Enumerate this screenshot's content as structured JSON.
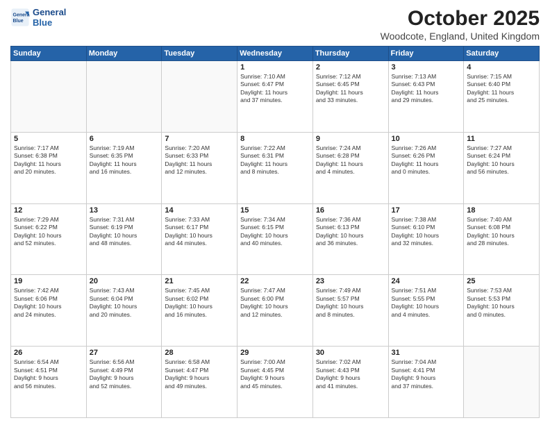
{
  "header": {
    "logo_line1": "General",
    "logo_line2": "Blue",
    "month": "October 2025",
    "location": "Woodcote, England, United Kingdom"
  },
  "weekdays": [
    "Sunday",
    "Monday",
    "Tuesday",
    "Wednesday",
    "Thursday",
    "Friday",
    "Saturday"
  ],
  "weeks": [
    [
      {
        "day": "",
        "info": ""
      },
      {
        "day": "",
        "info": ""
      },
      {
        "day": "",
        "info": ""
      },
      {
        "day": "1",
        "info": "Sunrise: 7:10 AM\nSunset: 6:47 PM\nDaylight: 11 hours\nand 37 minutes."
      },
      {
        "day": "2",
        "info": "Sunrise: 7:12 AM\nSunset: 6:45 PM\nDaylight: 11 hours\nand 33 minutes."
      },
      {
        "day": "3",
        "info": "Sunrise: 7:13 AM\nSunset: 6:43 PM\nDaylight: 11 hours\nand 29 minutes."
      },
      {
        "day": "4",
        "info": "Sunrise: 7:15 AM\nSunset: 6:40 PM\nDaylight: 11 hours\nand 25 minutes."
      }
    ],
    [
      {
        "day": "5",
        "info": "Sunrise: 7:17 AM\nSunset: 6:38 PM\nDaylight: 11 hours\nand 20 minutes."
      },
      {
        "day": "6",
        "info": "Sunrise: 7:19 AM\nSunset: 6:35 PM\nDaylight: 11 hours\nand 16 minutes."
      },
      {
        "day": "7",
        "info": "Sunrise: 7:20 AM\nSunset: 6:33 PM\nDaylight: 11 hours\nand 12 minutes."
      },
      {
        "day": "8",
        "info": "Sunrise: 7:22 AM\nSunset: 6:31 PM\nDaylight: 11 hours\nand 8 minutes."
      },
      {
        "day": "9",
        "info": "Sunrise: 7:24 AM\nSunset: 6:28 PM\nDaylight: 11 hours\nand 4 minutes."
      },
      {
        "day": "10",
        "info": "Sunrise: 7:26 AM\nSunset: 6:26 PM\nDaylight: 11 hours\nand 0 minutes."
      },
      {
        "day": "11",
        "info": "Sunrise: 7:27 AM\nSunset: 6:24 PM\nDaylight: 10 hours\nand 56 minutes."
      }
    ],
    [
      {
        "day": "12",
        "info": "Sunrise: 7:29 AM\nSunset: 6:22 PM\nDaylight: 10 hours\nand 52 minutes."
      },
      {
        "day": "13",
        "info": "Sunrise: 7:31 AM\nSunset: 6:19 PM\nDaylight: 10 hours\nand 48 minutes."
      },
      {
        "day": "14",
        "info": "Sunrise: 7:33 AM\nSunset: 6:17 PM\nDaylight: 10 hours\nand 44 minutes."
      },
      {
        "day": "15",
        "info": "Sunrise: 7:34 AM\nSunset: 6:15 PM\nDaylight: 10 hours\nand 40 minutes."
      },
      {
        "day": "16",
        "info": "Sunrise: 7:36 AM\nSunset: 6:13 PM\nDaylight: 10 hours\nand 36 minutes."
      },
      {
        "day": "17",
        "info": "Sunrise: 7:38 AM\nSunset: 6:10 PM\nDaylight: 10 hours\nand 32 minutes."
      },
      {
        "day": "18",
        "info": "Sunrise: 7:40 AM\nSunset: 6:08 PM\nDaylight: 10 hours\nand 28 minutes."
      }
    ],
    [
      {
        "day": "19",
        "info": "Sunrise: 7:42 AM\nSunset: 6:06 PM\nDaylight: 10 hours\nand 24 minutes."
      },
      {
        "day": "20",
        "info": "Sunrise: 7:43 AM\nSunset: 6:04 PM\nDaylight: 10 hours\nand 20 minutes."
      },
      {
        "day": "21",
        "info": "Sunrise: 7:45 AM\nSunset: 6:02 PM\nDaylight: 10 hours\nand 16 minutes."
      },
      {
        "day": "22",
        "info": "Sunrise: 7:47 AM\nSunset: 6:00 PM\nDaylight: 10 hours\nand 12 minutes."
      },
      {
        "day": "23",
        "info": "Sunrise: 7:49 AM\nSunset: 5:57 PM\nDaylight: 10 hours\nand 8 minutes."
      },
      {
        "day": "24",
        "info": "Sunrise: 7:51 AM\nSunset: 5:55 PM\nDaylight: 10 hours\nand 4 minutes."
      },
      {
        "day": "25",
        "info": "Sunrise: 7:53 AM\nSunset: 5:53 PM\nDaylight: 10 hours\nand 0 minutes."
      }
    ],
    [
      {
        "day": "26",
        "info": "Sunrise: 6:54 AM\nSunset: 4:51 PM\nDaylight: 9 hours\nand 56 minutes."
      },
      {
        "day": "27",
        "info": "Sunrise: 6:56 AM\nSunset: 4:49 PM\nDaylight: 9 hours\nand 52 minutes."
      },
      {
        "day": "28",
        "info": "Sunrise: 6:58 AM\nSunset: 4:47 PM\nDaylight: 9 hours\nand 49 minutes."
      },
      {
        "day": "29",
        "info": "Sunrise: 7:00 AM\nSunset: 4:45 PM\nDaylight: 9 hours\nand 45 minutes."
      },
      {
        "day": "30",
        "info": "Sunrise: 7:02 AM\nSunset: 4:43 PM\nDaylight: 9 hours\nand 41 minutes."
      },
      {
        "day": "31",
        "info": "Sunrise: 7:04 AM\nSunset: 4:41 PM\nDaylight: 9 hours\nand 37 minutes."
      },
      {
        "day": "",
        "info": ""
      }
    ]
  ]
}
